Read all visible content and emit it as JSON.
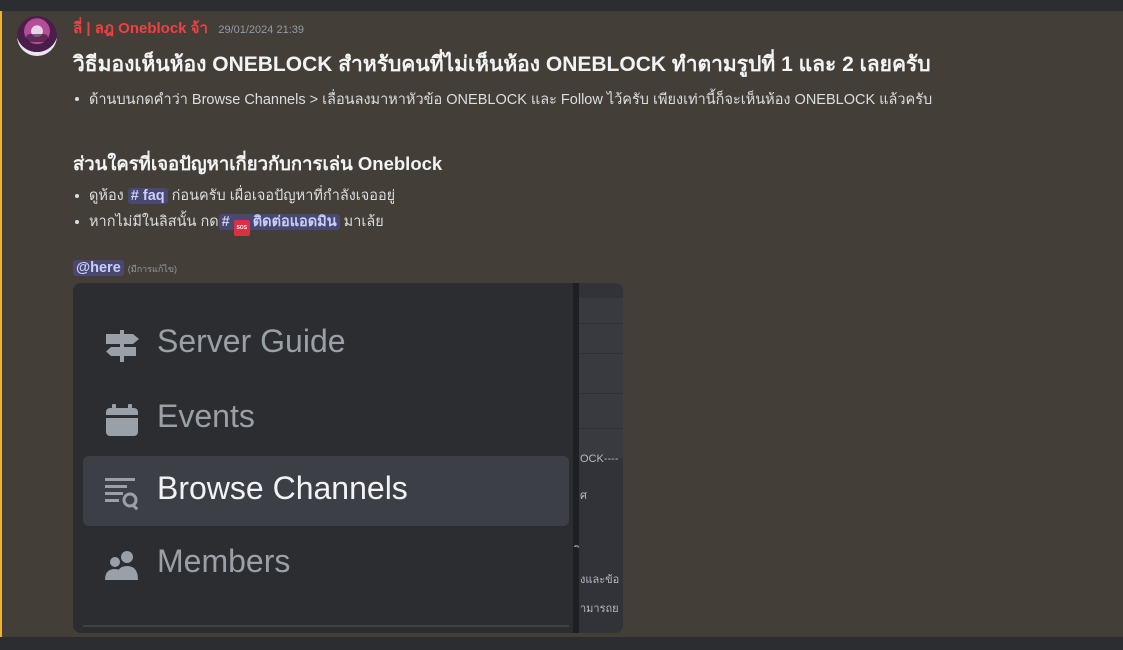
{
  "message": {
    "username": "ลี่ | ลฎ Oneblock จ้า",
    "timestamp": "29/01/2024 21:39",
    "title": "วิธีมองเห็นห้อง ONEBLOCK สำหรับคนที่ไม่เห็นห้อง ONEBLOCK ทำตามรูปที่ 1 และ 2 เลยครับ",
    "bullet1": "ด้านบนกดคำว่า Browse Channels > เลื่อนลงมาหาหัวข้อ ONEBLOCK และ Follow ไว้ครับ เพียงเท่านี้ก็จะเห็นห้อง ONEBLOCK แล้วครับ",
    "subheading": "ส่วนใครที่เจอปัญหาเกี่ยวกับการเล่น Oneblock",
    "bullet2": {
      "prefix": "ดูห้อง",
      "channel_hash": "#",
      "channel_name": "faq",
      "suffix": " ก่อนครับ เผื่อเจอปัญหาที่กำลังเจออยู่"
    },
    "bullet3": {
      "prefix": "หากไม่มีในลิสนั้น กด",
      "channel_hash": "#",
      "emoji_text": "SOS",
      "channel_name": "ติดต่อแอดมิน",
      "suffix": " มาเล้ย"
    },
    "mention": "@here",
    "edited": "(มีการแก้ไข)"
  },
  "attachment": {
    "menu_items": [
      {
        "label": "Server Guide",
        "icon": "signpost-icon"
      },
      {
        "label": "Events",
        "icon": "calendar-icon"
      },
      {
        "label": "Browse Channels",
        "icon": "browse-channels-icon"
      },
      {
        "label": "Members",
        "icon": "members-icon"
      }
    ],
    "active_item": "Browse Channels",
    "right_pane_fragments": [
      "OCK----",
      "ศ",
      "ิ",
      "งและข้อ",
      "ามารถย"
    ]
  },
  "colors": {
    "username": "#f23f42",
    "highlight_bg": "#433e38",
    "highlight_bar": "#f0b232",
    "mention_bg": "#3c4270"
  }
}
